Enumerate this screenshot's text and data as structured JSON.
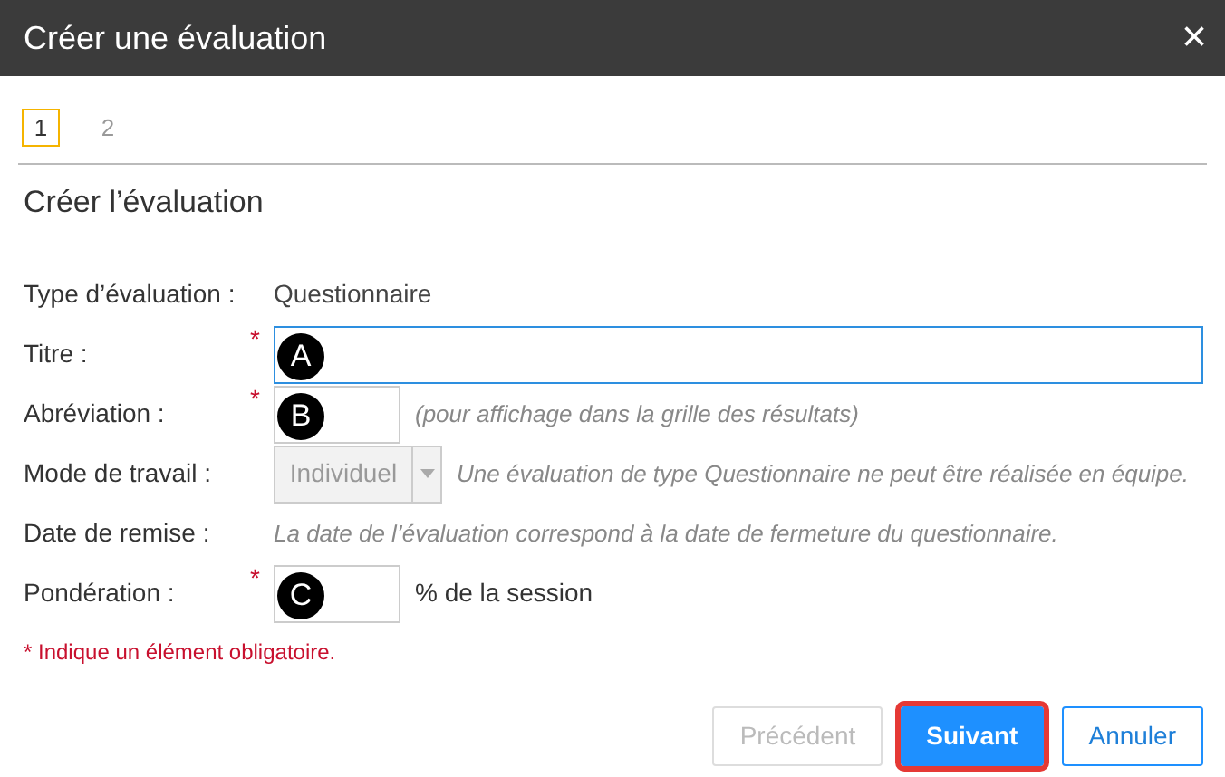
{
  "window": {
    "title": "Créer une évaluation",
    "close": "×"
  },
  "steps": [
    {
      "label": "1",
      "selected": true
    },
    {
      "label": "2",
      "selected": false
    }
  ],
  "section_title": "Créer l’évaluation",
  "fields": [
    {
      "kind": "text",
      "label": "Type d’évaluation :",
      "required": false,
      "value": "Questionnaire"
    },
    {
      "kind": "wide_input",
      "label": "Titre :",
      "required": true,
      "marker": "A",
      "focused": true
    },
    {
      "kind": "input",
      "label": "Abréviation :",
      "required": true,
      "marker": "B",
      "focused": false,
      "hint": "(pour affichage dans la grille des résultats)"
    },
    {
      "kind": "select",
      "label": "Mode de travail :",
      "required": false,
      "value": "Individuel",
      "disabled": true,
      "hint": "Une évaluation de type Questionnaire ne peut être réalisée en équipe."
    },
    {
      "kind": "note",
      "label": "Date de remise :",
      "required": false,
      "hint": "La date de l’évaluation correspond à la date de fermeture du questionnaire."
    },
    {
      "kind": "input",
      "label": "Pondération :",
      "required": true,
      "marker": "C",
      "focused": false,
      "suffix": "% de la session"
    }
  ],
  "required_mark": "*",
  "required_note": "* Indique un élément obligatoire.",
  "buttons": [
    {
      "label": "Précédent",
      "kind": "secondary",
      "disabled": true,
      "highlighted": false
    },
    {
      "label": "Suivant",
      "kind": "primary",
      "disabled": false,
      "highlighted": true
    },
    {
      "label": "Annuler",
      "kind": "secondary",
      "disabled": false,
      "highlighted": false
    }
  ]
}
